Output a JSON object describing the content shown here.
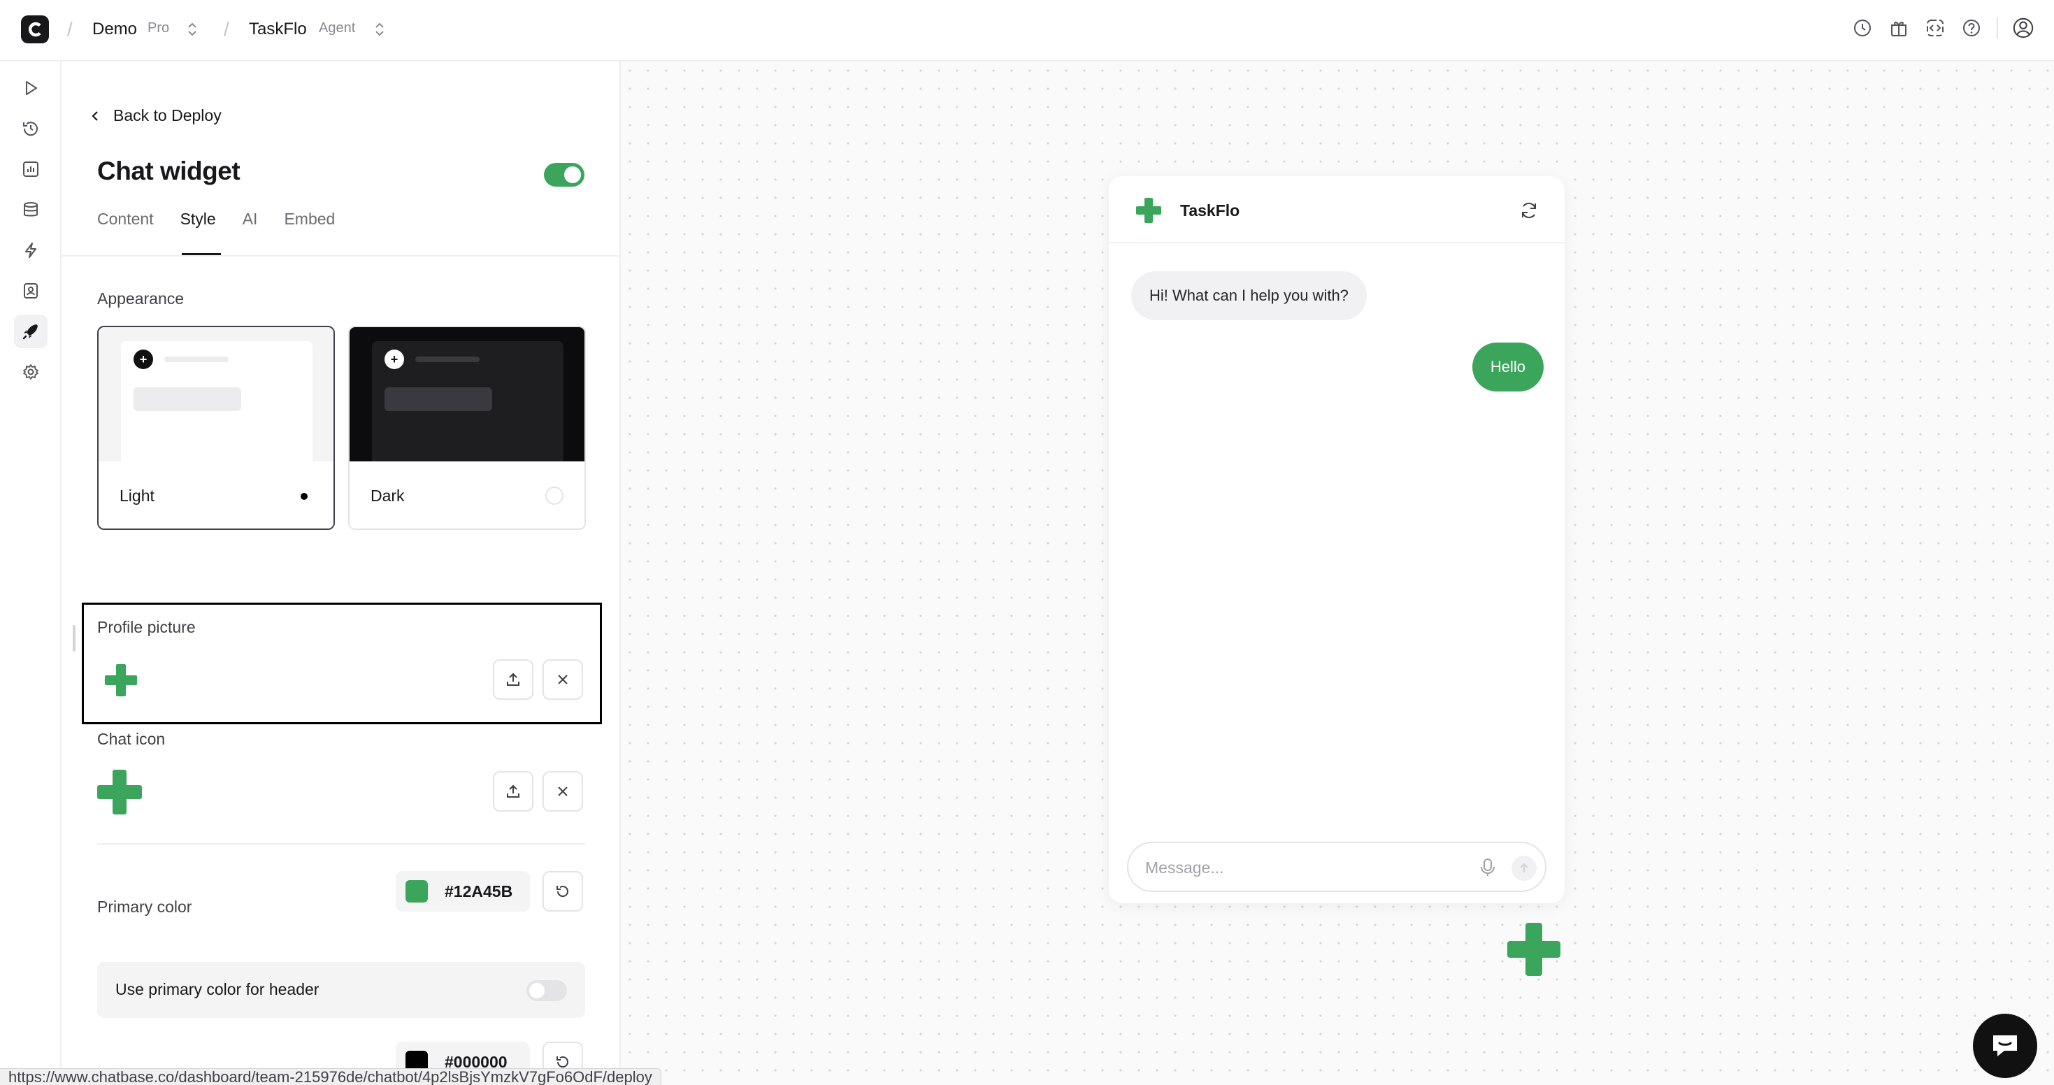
{
  "topbar": {
    "workspace": "Demo",
    "workspace_badge": "Pro",
    "agent": "TaskFlo",
    "agent_badge": "Agent",
    "icons": [
      "history-icon",
      "gift-icon",
      "code-icon",
      "help-icon",
      "account-icon"
    ]
  },
  "rail": {
    "icons": [
      "playground-icon",
      "activity-icon",
      "analytics-icon",
      "sources-icon",
      "actions-icon",
      "contacts-icon",
      "deploy-icon",
      "settings-icon"
    ],
    "active": "deploy-icon"
  },
  "panel": {
    "back_label": "Back to Deploy",
    "title": "Chat widget",
    "enabled": true,
    "tabs": [
      {
        "label": "Content"
      },
      {
        "label": "Style"
      },
      {
        "label": "AI"
      },
      {
        "label": "Embed"
      }
    ],
    "active_tab": "Style",
    "appearance": {
      "label": "Appearance",
      "options": [
        {
          "label": "Light",
          "selected": true
        },
        {
          "label": "Dark",
          "selected": false
        }
      ]
    },
    "profile_picture": {
      "label": "Profile picture"
    },
    "chat_icon": {
      "label": "Chat icon"
    },
    "primary_color": {
      "label": "Primary color",
      "value": "#12A45B",
      "swatch": "#3ca55c"
    },
    "header_switch": {
      "label": "Use primary color for header",
      "on": false
    },
    "secondary_color": {
      "value": "#000000",
      "swatch": "#000000"
    }
  },
  "preview": {
    "agent_name": "TaskFlo",
    "messages": [
      {
        "role": "bot",
        "text": "Hi! What can I help you with?"
      },
      {
        "role": "user",
        "text": "Hello"
      }
    ],
    "composer_placeholder": "Message..."
  },
  "status_url": "https://www.chatbase.co/dashboard/team-215976de/chatbot/4p2lsBjsYmzkV7gFo6OdF/deploy",
  "colors": {
    "accent": "#3ca55c",
    "text": "#18181b"
  }
}
